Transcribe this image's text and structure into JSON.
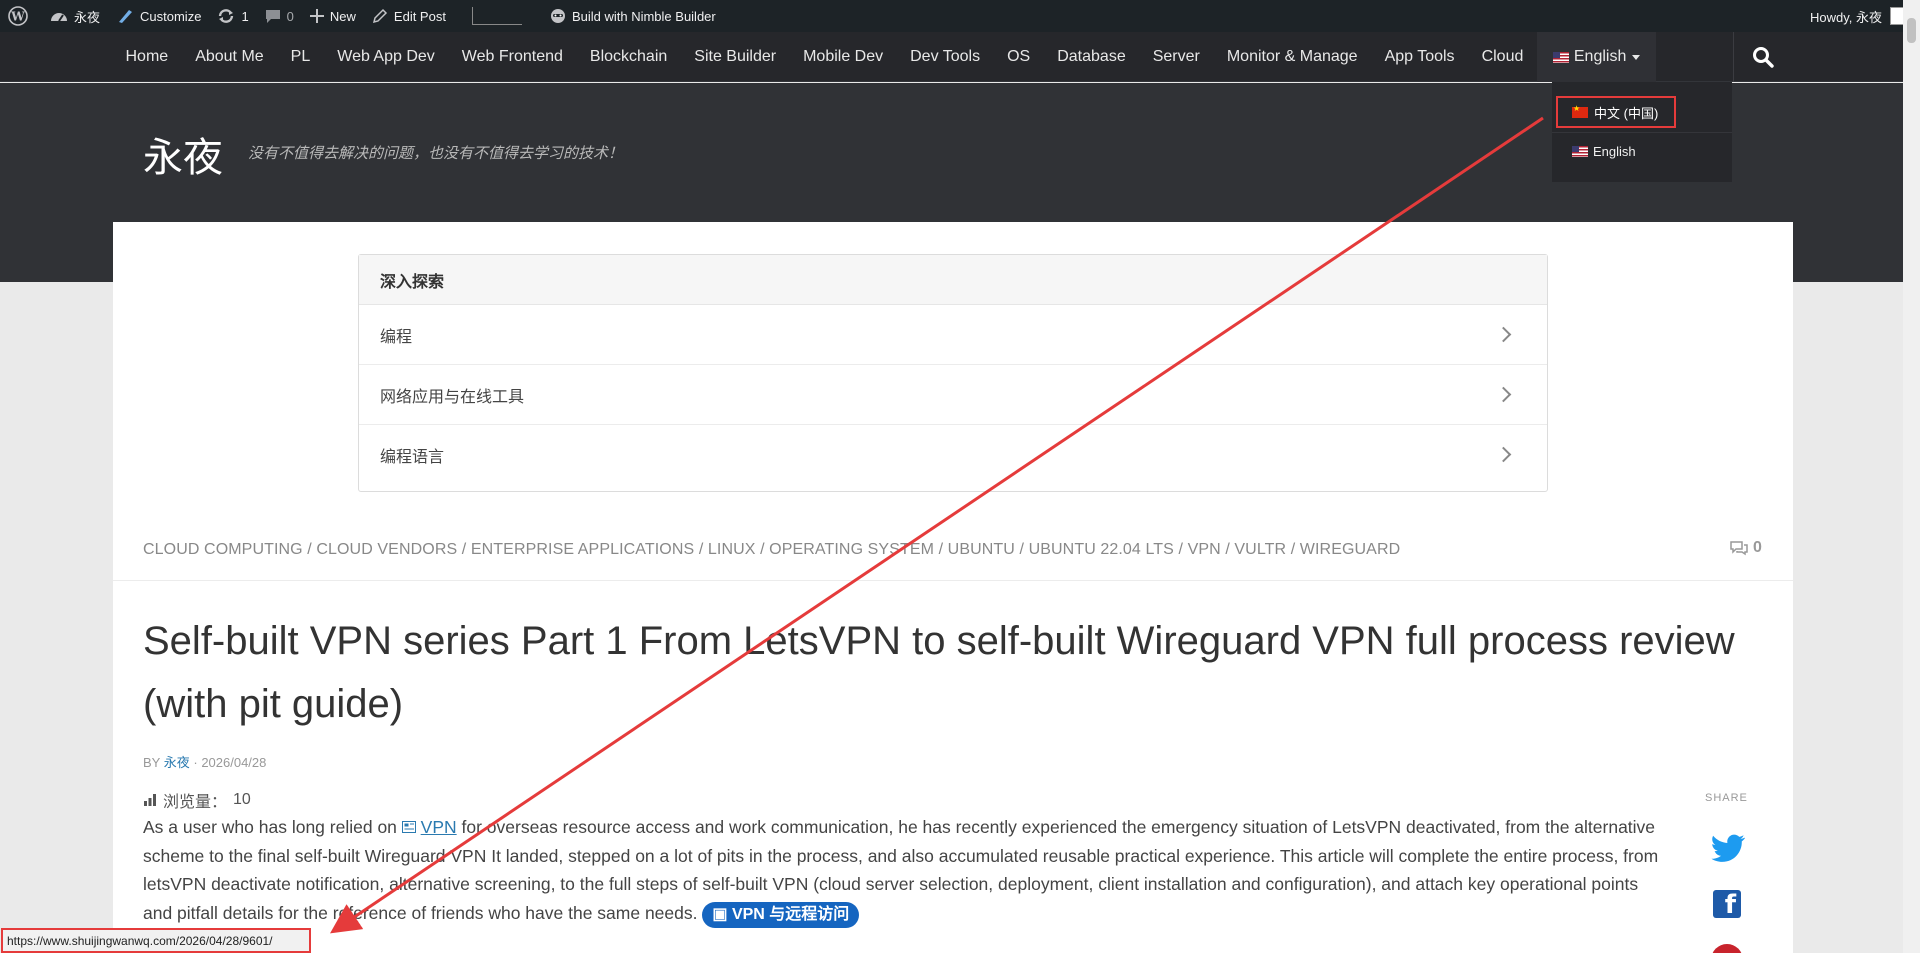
{
  "admin_bar": {
    "site_name": "永夜",
    "customize": "Customize",
    "updates_count": "1",
    "comments_count": "0",
    "new": "New",
    "edit_post": "Edit Post",
    "nimble": "Build with Nimble Builder",
    "howdy": "Howdy, 永夜"
  },
  "nav": {
    "items": [
      "Home",
      "About Me",
      "PL",
      "Web App Dev",
      "Web Frontend",
      "Blockchain",
      "Site Builder",
      "Mobile Dev",
      "Dev Tools",
      "OS",
      "Database",
      "Server",
      "Monitor & Manage",
      "App Tools",
      "Cloud"
    ],
    "language": "English"
  },
  "lang_dropdown": {
    "options": [
      "中文 (中国)",
      "English"
    ]
  },
  "header": {
    "site_title": "永夜",
    "tagline": "没有不值得去解决的问题，也没有不值得去学习的技术！"
  },
  "explore": {
    "title": "深入探索",
    "items": [
      "编程",
      "网络应用与在线工具",
      "编程语言"
    ]
  },
  "post": {
    "categories": "CLOUD COMPUTING / CLOUD VENDORS / ENTERPRISE APPLICATIONS / LINUX / OPERATING SYSTEM / UBUNTU / UBUNTU 22.04 LTS / VPN / VULTR / WIREGUARD",
    "comment_count": "0",
    "title": "Self-built VPN series Part 1 From LetsVPN to self-built Wireguard VPN full process review (with pit guide)",
    "by": "BY",
    "author": "永夜",
    "date": "· 2026/04/28",
    "views_label": "浏览量：",
    "views_value": "10",
    "body_before": "As a user who has long relied on",
    "body_kw": "VPN",
    "body_after": "for overseas resource access and work communication, he has recently experienced the emergency situation of LetsVPN deactivated, from the alternative scheme to the final self-built Wireguard VPN It landed, stepped on a lot of pits in the process, and also accumulated reusable practical experience. This article will complete the entire process, from letsVPN deactivate notification, alternative screening, to the full steps of self-built VPN (cloud server selection, deployment, client installation and configuration), and attach key operational points and pitfall details for the reference of friends who have the same needs.",
    "badge": "VPN 与远程访问"
  },
  "share": {
    "label": "SHARE"
  },
  "status_url": "https://www.shuijingwanwq.com/2026/04/28/9601/",
  "colors": {
    "admin_bg": "#1d2327",
    "nav_bg": "#26272b",
    "header_bg": "#303236",
    "highlight": "#e53b3b",
    "badge": "#1565c0"
  }
}
